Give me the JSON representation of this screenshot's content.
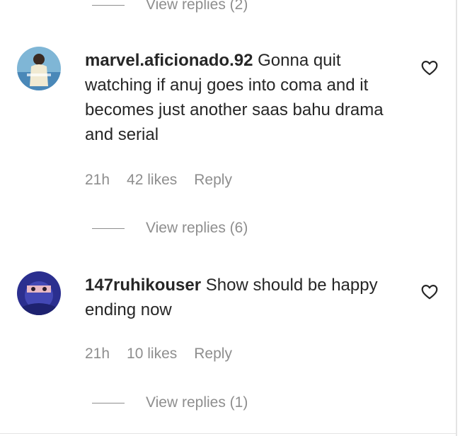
{
  "top_thread": {
    "view_replies": "View replies (2)"
  },
  "comments": [
    {
      "username": "marvel.aficionado.92",
      "text": "Gonna quit watching if anuj goes into coma and it becomes just another saas bahu drama and serial",
      "time": "21h",
      "likes": "42 likes",
      "reply": "Reply",
      "view_replies": "View replies (6)"
    },
    {
      "username": "147ruhikouser",
      "text": "Show should be happy ending now",
      "time": "21h",
      "likes": "10 likes",
      "reply": "Reply",
      "view_replies": "View replies (1)"
    }
  ],
  "icons": {
    "like": "heart-outline-icon"
  },
  "colors": {
    "text": "#262626",
    "muted": "#8e8e8e",
    "divider": "#e4e4e4"
  }
}
